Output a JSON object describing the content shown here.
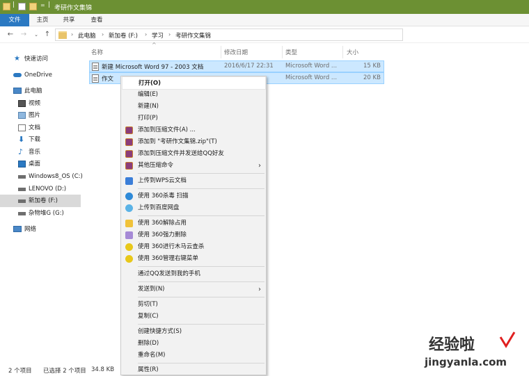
{
  "window": {
    "title": "考研作文集锦"
  },
  "ribbon": {
    "tabs": [
      "文件",
      "主页",
      "共享",
      "查看"
    ]
  },
  "address": {
    "crumbs": [
      "此电脑",
      "新加卷 (F:)",
      "学习",
      "考研作文集锦"
    ]
  },
  "sidebar": {
    "items": [
      {
        "label": "快速访问",
        "icon": "star-icon"
      },
      {
        "label": "OneDrive",
        "icon": "cloud-icon"
      },
      {
        "label": "此电脑",
        "icon": "computer-icon"
      },
      {
        "label": "视频",
        "icon": "video-icon"
      },
      {
        "label": "图片",
        "icon": "picture-icon"
      },
      {
        "label": "文档",
        "icon": "document-icon"
      },
      {
        "label": "下载",
        "icon": "download-icon"
      },
      {
        "label": "音乐",
        "icon": "music-icon"
      },
      {
        "label": "桌面",
        "icon": "desktop-icon"
      },
      {
        "label": "Windows8_OS (C:)",
        "icon": "drive-icon"
      },
      {
        "label": "LENOVO (D:)",
        "icon": "drive-icon"
      },
      {
        "label": "新加卷 (F:)",
        "icon": "drive-icon"
      },
      {
        "label": "杂物堆G (G:)",
        "icon": "drive-icon"
      },
      {
        "label": "网络",
        "icon": "network-icon"
      }
    ]
  },
  "columns": {
    "name": "名称",
    "date": "修改日期",
    "type": "类型",
    "size": "大小"
  },
  "files": [
    {
      "name": "新建 Microsoft Word 97 - 2003 文档",
      "date": "2016/6/17 22:31",
      "type": "Microsoft Word ...",
      "size": "15 KB"
    },
    {
      "name": "作文",
      "date": "",
      "type": "Microsoft Word ...",
      "size": "20 KB"
    }
  ],
  "context_menu": {
    "items": [
      {
        "label": "打开(O)",
        "icon": "",
        "submenu": false
      },
      {
        "label": "编辑(E)",
        "icon": "",
        "submenu": false
      },
      {
        "label": "新建(N)",
        "icon": "",
        "submenu": false
      },
      {
        "label": "打印(P)",
        "icon": "",
        "submenu": false
      },
      {
        "label": "添加到压缩文件(A) ...",
        "icon": "winrar-icon",
        "submenu": false
      },
      {
        "label": "添加到 \"考研作文集锦.zip\"(T)",
        "icon": "winrar-icon",
        "submenu": false
      },
      {
        "label": "添加到压缩文件并发送给QQ好友",
        "icon": "winrar-icon",
        "submenu": false
      },
      {
        "label": "其他压缩命令",
        "icon": "winrar-icon",
        "submenu": true
      },
      {
        "label": "上传到WPS云文档",
        "icon": "wps-cloud-icon",
        "submenu": false
      },
      {
        "label": "使用 360杀毒 扫描",
        "icon": "360-antivirus-icon",
        "submenu": false
      },
      {
        "label": "上传到百度网盘",
        "icon": "baidu-netdisk-icon",
        "submenu": false
      },
      {
        "label": "使用 360解除占用",
        "icon": "360-unlock-icon",
        "submenu": false
      },
      {
        "label": "使用 360强力删除",
        "icon": "360-shred-icon",
        "submenu": false
      },
      {
        "label": "使用 360进行木马云查杀",
        "icon": "360-trojan-icon",
        "submenu": false
      },
      {
        "label": "使用 360管理右键菜单",
        "icon": "360-menu-icon",
        "submenu": false
      },
      {
        "label": "通过QQ发送到我的手机",
        "icon": "",
        "submenu": false
      },
      {
        "label": "发送到(N)",
        "icon": "",
        "submenu": true
      },
      {
        "label": "剪切(T)",
        "icon": "",
        "submenu": false
      },
      {
        "label": "复制(C)",
        "icon": "",
        "submenu": false
      },
      {
        "label": "创建快捷方式(S)",
        "icon": "",
        "submenu": false
      },
      {
        "label": "删除(D)",
        "icon": "",
        "submenu": false
      },
      {
        "label": "重命名(M)",
        "icon": "",
        "submenu": false
      },
      {
        "label": "属性(R)",
        "icon": "",
        "submenu": false
      }
    ]
  },
  "status": {
    "count": "2 个项目",
    "selected": "已选择 2 个项目",
    "size": "34.8 KB"
  },
  "watermark": {
    "line1": "经验啦",
    "line2": "jingyanla.com"
  },
  "colors": {
    "titlebar": "#6c9033",
    "file_tab": "#2b79c2",
    "selection": "#cce8ff"
  }
}
